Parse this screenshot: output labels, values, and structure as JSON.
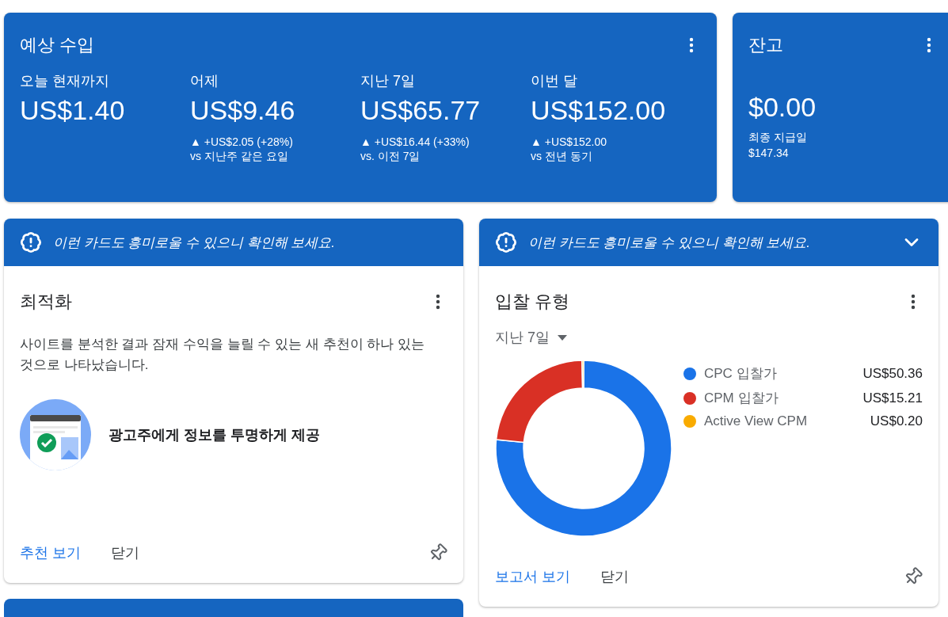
{
  "earnings": {
    "title": "예상 수입",
    "metrics": [
      {
        "label": "오늘 현재까지",
        "value": "US$1.40"
      },
      {
        "label": "어제",
        "value": "US$9.46",
        "change": "▲ +US$2.05 (+28%)",
        "comparison": "vs 지난주 같은 요일"
      },
      {
        "label": "지난 7일",
        "value": "US$65.77",
        "change": "▲ +US$16.44 (+33%)",
        "comparison": "vs. 이전 7일"
      },
      {
        "label": "이번 달",
        "value": "US$152.00",
        "change": "▲ +US$152.00",
        "comparison": "vs 전년 동기"
      }
    ]
  },
  "balance": {
    "title": "잔고",
    "value": "$0.00",
    "last_payment_label": "최종 지급일",
    "last_payment": "$147.34"
  },
  "cards": [
    {
      "kind": "recommendation",
      "banner": "이런 카드도 흥미로울 수 있으니 확인해 보세요.",
      "collapsible": false,
      "title": "최적화",
      "description": "사이트를 분석한 결과 잠재 수익을 늘릴 수 있는 새 추천이 하나 있는 것으로 나타났습니다.",
      "recommendation": "광고주에게 정보를 투명하게 제공",
      "actions": [
        "추천 보기",
        "닫기"
      ]
    },
    {
      "kind": "chart",
      "banner": "이런 카드도 흥미로울 수 있으니 확인해 보세요.",
      "collapsible": true,
      "title": "입찰 유형",
      "period": "지난 7일",
      "legend": [
        {
          "value": "US$50.36",
          "color": "#1a73e8"
        },
        {
          "value": "US$15.21",
          "color": "#d93025"
        },
        {
          "value": "US$0.20",
          "color": "#f9ab00"
        }
      ],
      "chart_data": {
        "type": "donut",
        "categories": [
          "CPC 입찰가",
          "CPM 입찰가",
          "Active View CPM"
        ],
        "values": [
          76.57,
          23.13,
          0.3
        ]
      },
      "actions": [
        "보고서 보기",
        "닫기"
      ]
    }
  ]
}
